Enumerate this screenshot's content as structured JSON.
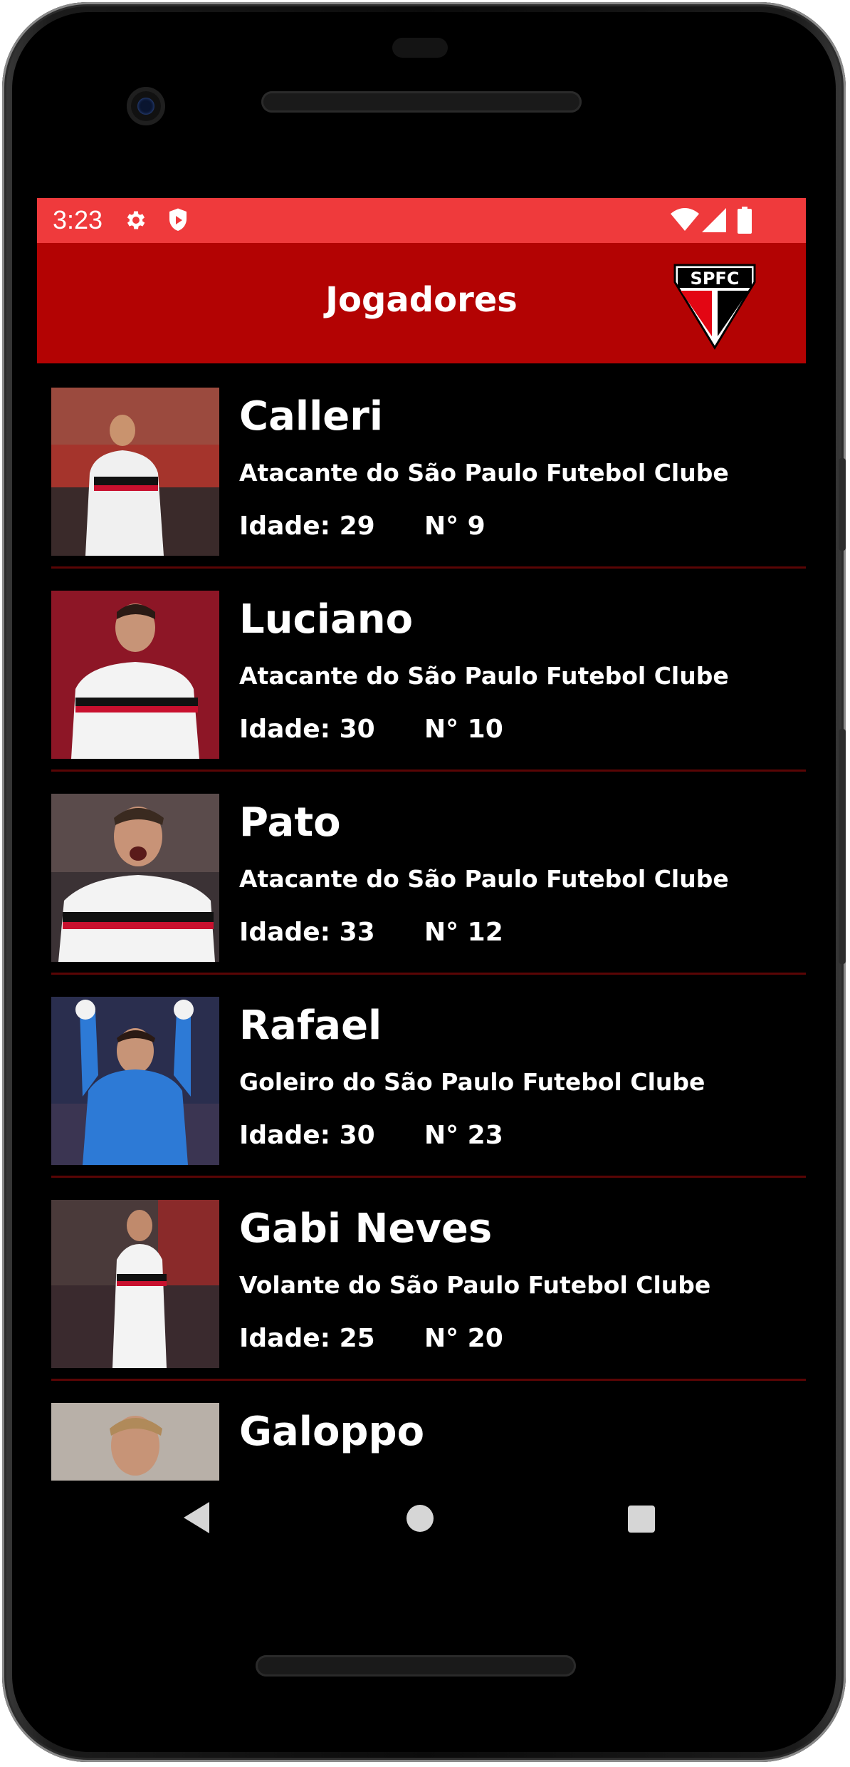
{
  "status_bar": {
    "time": "3:23",
    "icons": [
      "gear-icon",
      "shield-icon",
      "wifi-icon",
      "signal-icon",
      "battery-icon"
    ],
    "color": "#ef3a3c"
  },
  "app_bar": {
    "title": "Jogadores",
    "logo_text": "SPFC",
    "color": "#b30303"
  },
  "players": [
    {
      "name": "Calleri",
      "role": "Atacante do São Paulo Futebol Clube",
      "age": "Idade: 29",
      "number": "N° 9"
    },
    {
      "name": "Luciano",
      "role": "Atacante do São Paulo Futebol Clube",
      "age": "Idade: 30",
      "number": "N° 10"
    },
    {
      "name": "Pato",
      "role": "Atacante do São Paulo Futebol Clube",
      "age": "Idade: 33",
      "number": "N° 12"
    },
    {
      "name": "Rafael",
      "role": "Goleiro do São Paulo Futebol Clube",
      "age": "Idade: 30",
      "number": "N° 23"
    },
    {
      "name": "Gabi Neves",
      "role": "Volante do São Paulo Futebol Clube",
      "age": "Idade: 25",
      "number": "N° 20"
    },
    {
      "name": "Galoppo"
    }
  ],
  "nav_bar": {
    "buttons": [
      "back-icon",
      "home-icon",
      "recents-icon"
    ]
  }
}
